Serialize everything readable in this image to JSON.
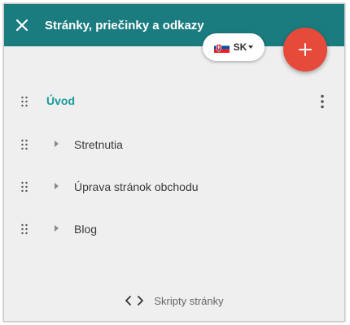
{
  "header": {
    "title": "Stránky, priečinky a odkazy",
    "close_icon": "close-icon",
    "color": "#1b7c80"
  },
  "language": {
    "code": "SK",
    "flag_icon": "slovak-flag-icon"
  },
  "add_button": {
    "icon": "plus-icon",
    "color": "#e64a3b"
  },
  "pages": [
    {
      "label": "Úvod",
      "level": 0,
      "accent": "#1a9a9a"
    },
    {
      "label": "Stretnutia",
      "level": 1
    },
    {
      "label": "Úprava stránok obchodu",
      "level": 1
    },
    {
      "label": "Blog",
      "level": 1
    }
  ],
  "footer": {
    "label": "Skripty stránky",
    "icon": "code-icon"
  }
}
